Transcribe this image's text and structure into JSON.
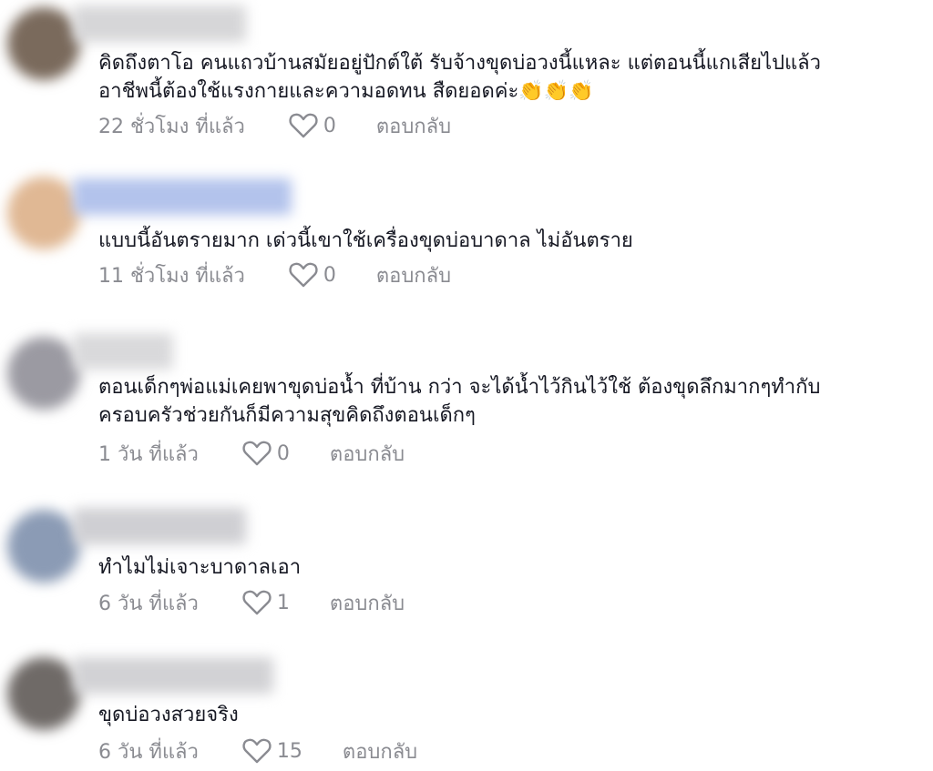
{
  "comments": [
    {
      "text": "คิดถึงตาโอ คนแถวบ้านสมัยอยู่ปักต์ใต้ รับจ้างขุดบ่อวงนี้แหละ แต่ตอนนี้แกเสียไปแล้ว\nอาชีพนี้ต้องใช้แรงกายและความอดทน สืดยอดค่ะ👏👏👏",
      "time": "22 ชั่วโมง ที่แล้ว",
      "likes": "0",
      "reply": "ตอบกลับ",
      "avatar_color": "#7a6a5c",
      "name_color": "#d6d6d8"
    },
    {
      "text": "แบบนี้อันตรายมาก เด่วนี้เขาใช้เครื่องขุดบ่อบาดาล ไม่อันตราย",
      "time": "11 ชั่วโมง ที่แล้ว",
      "likes": "0",
      "reply": "ตอบกลับ",
      "avatar_color": "#e0b894",
      "name_color": "#b3c3ec"
    },
    {
      "text": "ตอนเด็กๆพ่อแม่เคยพาขุดบ่อน้ำ ที่บ้าน กว่า จะได้น้ำไว้กินไว้ใช้ ต้องขุดลึกมากๆทำกับ\nครอบครัวช่วยกันก็มีความสุขคิดถึงตอนเด็กๆ",
      "time": "1 วัน ที่แล้ว",
      "likes": "0",
      "reply": "ตอบกลับ",
      "avatar_color": "#9b9aa2",
      "name_color": "#d9d9db"
    },
    {
      "text": "ทำไมไม่เจาะบาดาลเอา",
      "time": "6 วัน ที่แล้ว",
      "likes": "1",
      "reply": "ตอบกลับ",
      "avatar_color": "#8b9bb5",
      "name_color": "#cfcfd3"
    },
    {
      "text": "ขุดบ่อวงสวยจริง",
      "time": "6 วัน ที่แล้ว",
      "likes": "15",
      "reply": "ตอบกลับ",
      "avatar_color": "#6f6a67",
      "name_color": "#d2d2d5"
    }
  ]
}
